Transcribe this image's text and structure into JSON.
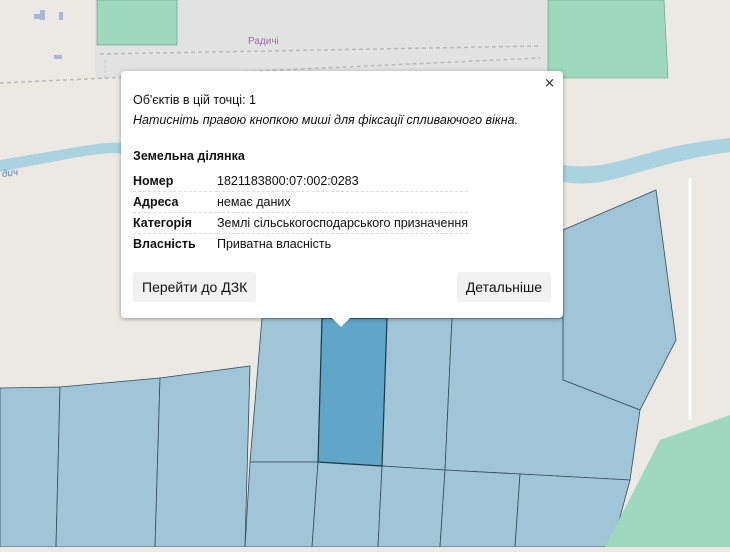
{
  "map": {
    "place_label": "Радичі",
    "river_label": "дич",
    "colors": {
      "background": "#ece9e4",
      "road": "#e3e3e3",
      "river": "#aad3df",
      "parcel": "#9fc5d6",
      "parcel_selected": "#5fa6c9",
      "parcel_border": "#2f4d5b",
      "green_area": "#9ed8bf"
    }
  },
  "popup": {
    "close_symbol": "×",
    "objects_count": "Об'єктів в цій точці: 1",
    "hint": "Натисніть правою кнопкою миші для фіксації спливаючого вікна.",
    "section_title": "Земельна ділянка",
    "properties": [
      {
        "key": "Номер",
        "value": "1821183800:07:002:0283"
      },
      {
        "key": "Адреса",
        "value": "немає даних"
      },
      {
        "key": "Категорія",
        "value": "Землі сільськогосподарського призначення"
      },
      {
        "key": "Власність",
        "value": "Приватна власність"
      }
    ],
    "go_button": "Перейти до ДЗК",
    "details_button": "Детальніше"
  }
}
